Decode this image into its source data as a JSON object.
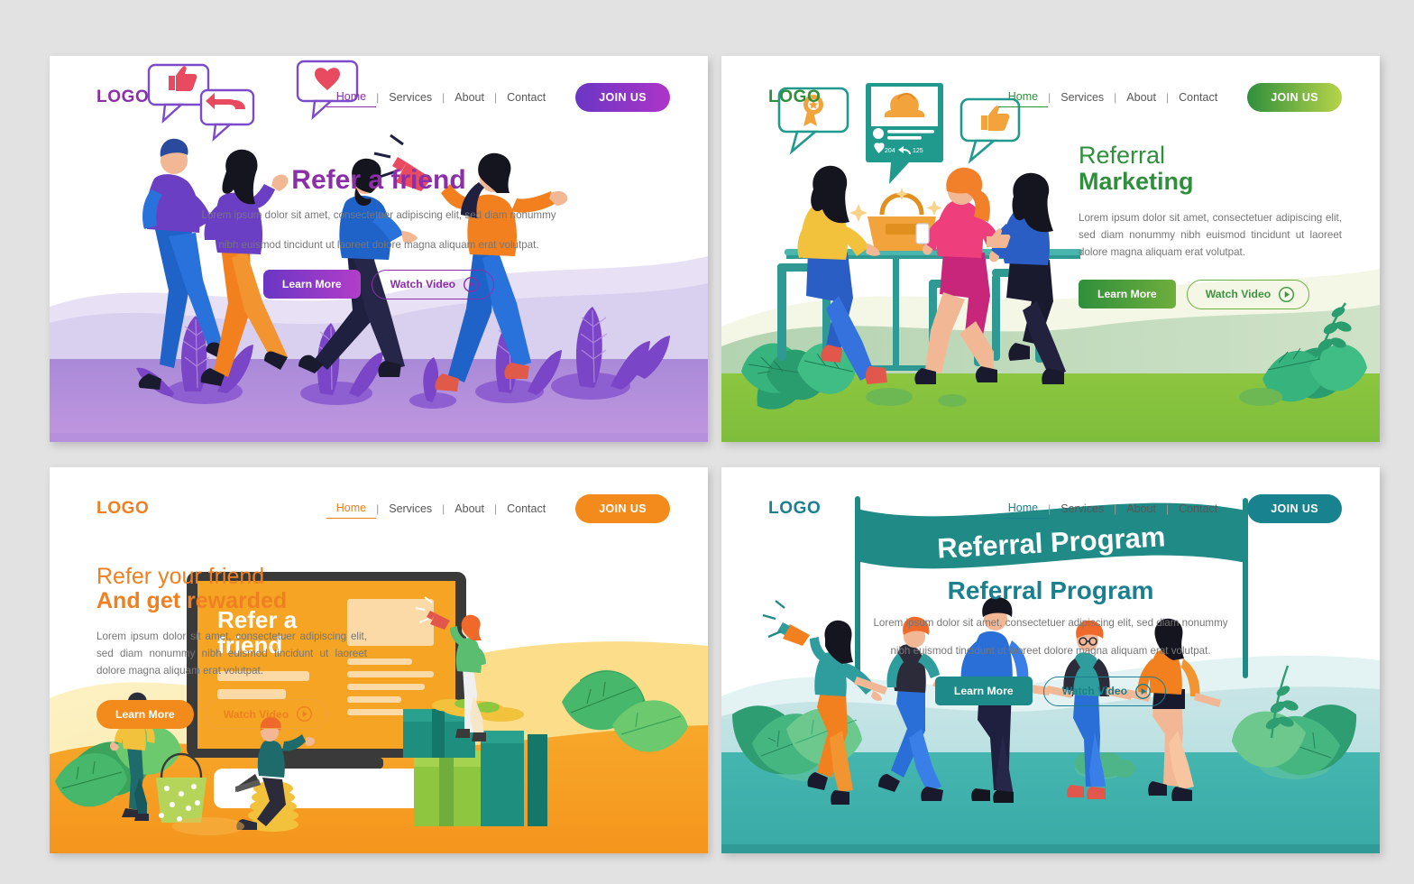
{
  "nav": {
    "items": [
      {
        "label": "Home",
        "active": true
      },
      {
        "label": "Services",
        "active": false
      },
      {
        "label": "About",
        "active": false
      },
      {
        "label": "Contact",
        "active": false
      }
    ],
    "separator": "|",
    "cta_label": "JOIN US"
  },
  "common": {
    "logo": "LOGO",
    "learn_more": "Learn More",
    "watch_video": "Watch Video",
    "body_line1": "Lorem ipsum dolor sit amet, consectetuer adipiscing elit, sed diam nonummy",
    "body_line2": "nibh euismod tincidunt ut laoreet dolore magna aliquam erat volutpat.",
    "body_block": "Lorem ipsum dolor sit amet, consectetuer adipiscing elit, sed diam nonummy nibh euismod tincidunt ut laoreet dolore magna aliquam erat volutpat."
  },
  "panels": [
    {
      "id": "p1",
      "theme": "purple",
      "accent": "#8b2fa8",
      "logo": "LOGO",
      "heading": "Refer a friend",
      "heading_line1": "",
      "heading_line2": "",
      "body": "Lorem ipsum dolor sit amet, consectetuer adipiscing elit, sed diam nonummy nibh euismod tincidunt ut laoreet dolore magna aliquam erat volutpat.",
      "learn_more": "Learn More",
      "watch_video": "Watch Video",
      "join_us": "JOIN US",
      "illustration": "people-running-with-speech-bubbles-and-megaphone"
    },
    {
      "id": "p2",
      "theme": "green",
      "accent": "#2f8f3c",
      "logo": "LOGO",
      "heading": "Referral Marketing",
      "heading_line1": "Referral",
      "heading_line2": "Marketing",
      "body": "Lorem ipsum dolor sit amet, consectetuer adipiscing elit, sed diam nonummy nibh euismod tincidunt ut laoreet dolore magna aliquam erat volutpat.",
      "learn_more": "Learn More",
      "watch_video": "Watch Video",
      "join_us": "JOIN US",
      "illustration": "three-women-at-table-with-social-post-card",
      "social_card": {
        "likes": "204",
        "shares": "125"
      }
    },
    {
      "id": "p3",
      "theme": "orange",
      "accent": "#ef8021",
      "logo": "LOGO",
      "heading": "Refer your friend And get rewarded",
      "heading_line1": "Refer your friend",
      "heading_line2": "And get rewarded",
      "body": "Lorem ipsum dolor sit amet, consectetuer adipiscing elit, sed diam nonummy nibh euismod tincidunt ut laoreet dolore magna aliquam erat volutpat.",
      "learn_more": "Learn More",
      "watch_video": "Watch Video",
      "join_us": "JOIN US",
      "illustration": "monitor-with-refer-a-friend-page-gifts-and-coins",
      "screen_title_line1": "Refer a",
      "screen_title_line2": "friend"
    },
    {
      "id": "p4",
      "theme": "teal",
      "accent": "#1a7f8e",
      "logo": "LOGO",
      "heading": "Referral Program",
      "heading_line1": "",
      "heading_line2": "",
      "body": "Lorem ipsum dolor sit amet, consectetuer adipiscing elit, sed diam nonummy nibh euismod tincidunt ut laoreet dolore magna aliquam erat volutpat.",
      "learn_more": "Learn More",
      "watch_video": "Watch Video",
      "join_us": "JOIN US",
      "illustration": "five-people-holding-hands-under-referral-program-banner",
      "banner_text": "Referral Program"
    }
  ]
}
